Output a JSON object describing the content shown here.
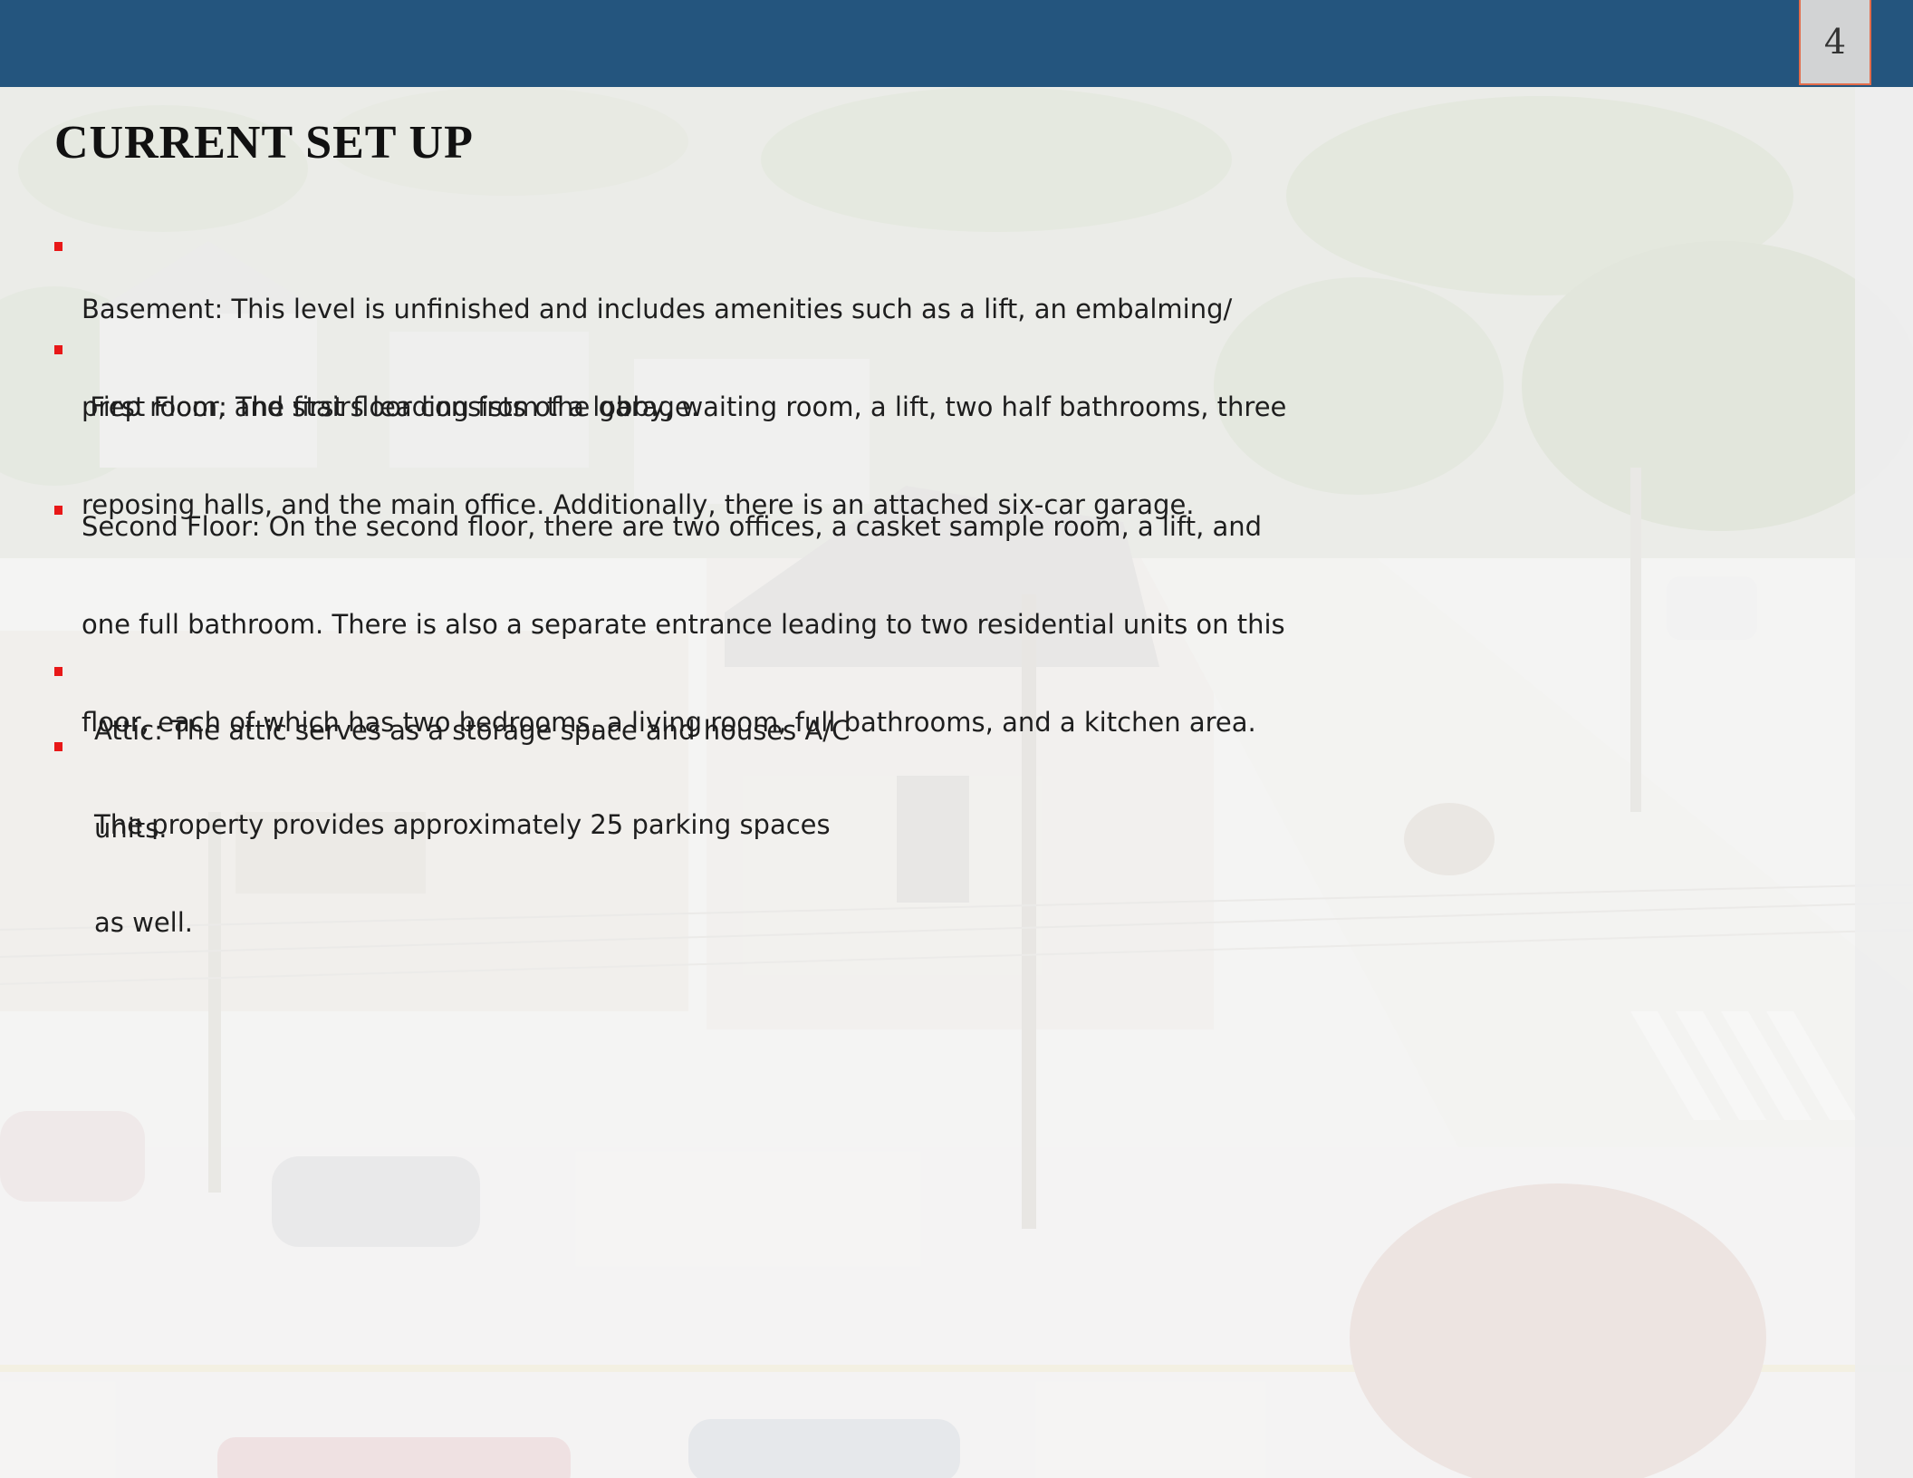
{
  "header": {
    "page_number": "4",
    "bar_color": "#24557e",
    "tab_border_color": "#e36c4a"
  },
  "title": "CURRENT SET UP",
  "bullet_color": "#e81818",
  "bullets": [
    {
      "lines": [
        "Basement: This level is unfinished and includes amenities such as a lift, an embalming/",
        "prep room, and stairs leading from the garage."
      ]
    },
    {
      "lines": [
        " First Floor: The first floor consists of a lobby, waiting room, a lift, two half bathrooms, three",
        "reposing halls, and the main office. Additionally, there is an attached six-car garage."
      ]
    },
    {
      "lines": [
        "Second Floor: On the second floor, there are two offices, a casket sample room, a lift, and",
        "one full bathroom. There is also a separate entrance leading to two residential units on this",
        "floor, each of which has two bedrooms, a living room, full bathrooms, and a kitchen area."
      ]
    },
    {
      "lines": [
        "Attic: The attic serves as a storage space and houses A/C",
        "units."
      ]
    },
    {
      "lines": [
        "The property provides approximately 25 parking spaces",
        "as well."
      ]
    }
  ],
  "background": {
    "image": "aerial-street-view-photo",
    "overlay": "white-wash"
  }
}
